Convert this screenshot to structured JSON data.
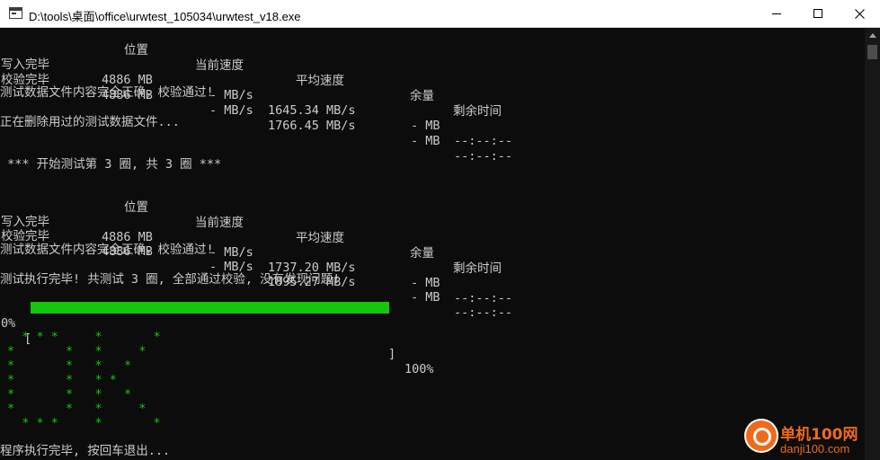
{
  "window": {
    "title": "D:\\tools\\桌面\\office\\urwtest_105034\\urwtest_v18.exe"
  },
  "headers": {
    "position": "位置",
    "current_speed": "当前速度",
    "avg_speed": "平均速度",
    "remain": "余量",
    "time_left": "剩余时间"
  },
  "round1": {
    "rows": [
      {
        "label": "写入完毕",
        "position": "4886 MB",
        "current": "- MB/s",
        "avg": "1645.34 MB/s",
        "remain": "- MB",
        "time": "--:--:--"
      },
      {
        "label": "校验完毕",
        "position": "4886 MB",
        "current": "- MB/s",
        "avg": "1766.45 MB/s",
        "remain": "- MB",
        "time": "--:--:--"
      }
    ],
    "verify_ok": "测试数据文件内容完全正确，校验通过!"
  },
  "deleting": "正在删除用过的测试数据文件...",
  "round_start": " *** 开始测试第 3 圈, 共 3 圈 ***",
  "round3": {
    "rows": [
      {
        "label": "写入完毕",
        "position": "4886 MB",
        "current": "- MB/s",
        "avg": "1737.20 MB/s",
        "remain": "- MB",
        "time": "--:--:--"
      },
      {
        "label": "校验完毕",
        "position": "4886 MB",
        "current": "- MB/s",
        "avg": "1895.27 MB/s",
        "remain": "- MB",
        "time": "--:--:--"
      }
    ],
    "verify_ok": "测试数据文件内容完全正确，校验通过!"
  },
  "summary": "测试执行完毕! 共测试 3 圈, 全部通过校验, 没有发现问题!",
  "progress": {
    "start_label": "0%",
    "open_bracket": "[",
    "close_bracket": "]",
    "end_label": "100%",
    "fraction": 1.0,
    "color": "#16c60c"
  },
  "ok_art": [
    "  * * *     *       *",
    "*       *   *     *",
    "*       *   *   *",
    "*       *   * *",
    "*       *   *   *",
    "*       *   *     *",
    "  * * *     *       *"
  ],
  "exit_prompt": "程序执行完毕, 按回车退出...",
  "watermark": {
    "brand": "单机100网",
    "domain": "danji100.com"
  },
  "colors": {
    "console_bg": "#0c0c0c",
    "console_text": "#cccccc",
    "ok_green": "#16c60c",
    "watermark": "#f06a1b"
  }
}
